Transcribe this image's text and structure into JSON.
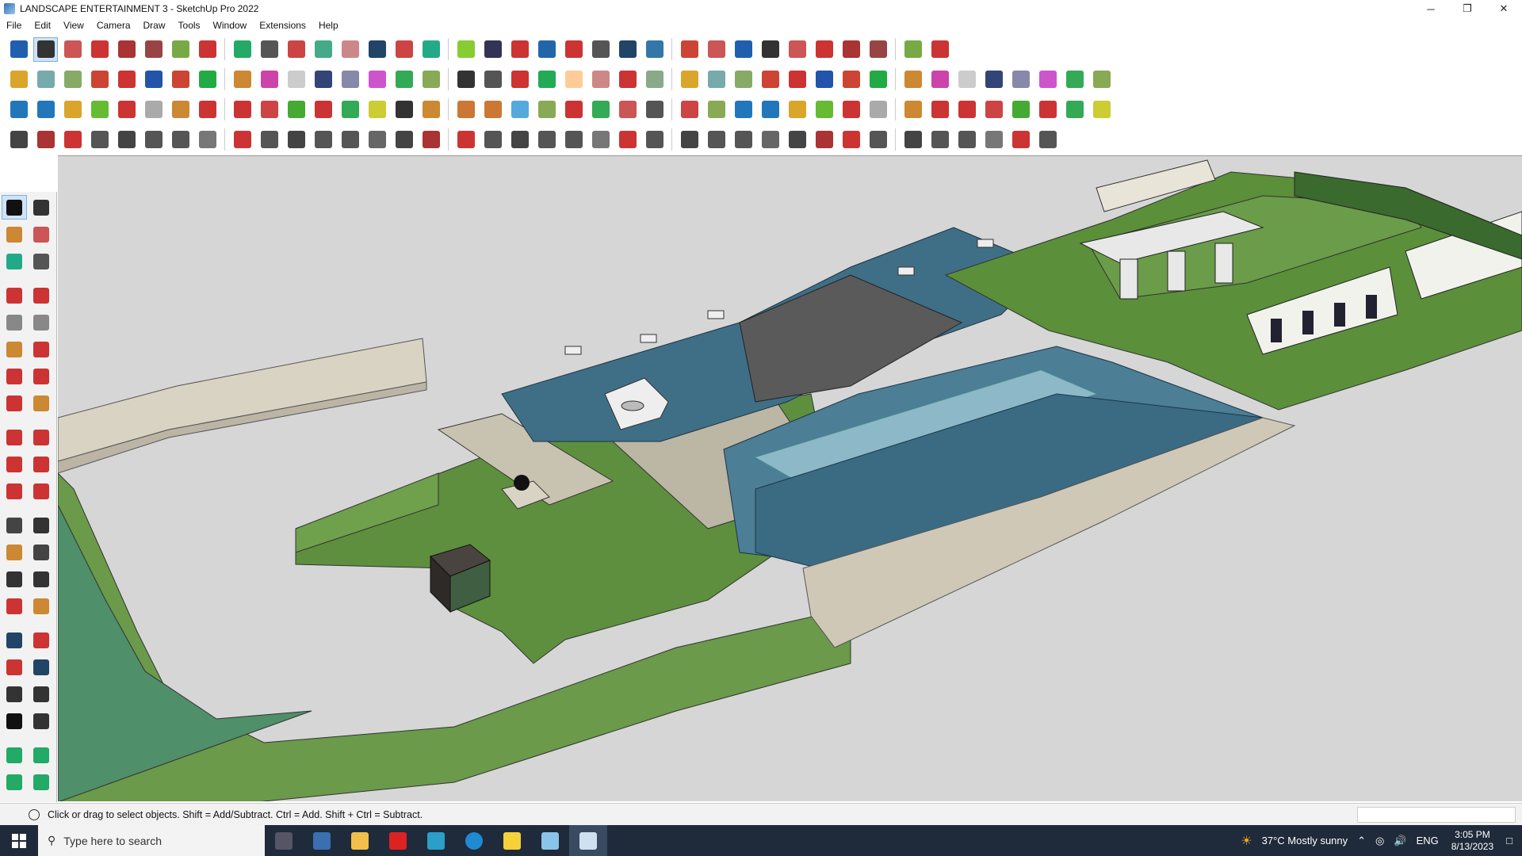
{
  "window": {
    "title": "LANDSCAPE ENTERTAINMENT 3 - SketchUp Pro 2022",
    "minimize": "─",
    "restore": "❐",
    "close": "✕"
  },
  "menu": [
    "File",
    "Edit",
    "View",
    "Camera",
    "Draw",
    "Tools",
    "Window",
    "Extensions",
    "Help"
  ],
  "toolbar_rows": [
    {
      "count": 34,
      "colors": [
        "#1f5fae",
        "#333",
        "#c55",
        "#c33",
        "#a33",
        "#944",
        "#7a4",
        "#c33",
        "#2a6",
        "#555",
        "#c44",
        "#4a8",
        "#c88",
        "#246",
        "#c44",
        "#2a8",
        "#8c3",
        "#335",
        "#c33",
        "#26a",
        "#c33",
        "#555",
        "#246",
        "#37a",
        "#c43",
        "#c55"
      ]
    },
    {
      "count": 40,
      "colors": [
        "#d9a52b",
        "#7aa",
        "#8a6",
        "#c43",
        "#c33",
        "#25a",
        "#c43",
        "#2a4",
        "#c83",
        "#c4a",
        "#ccc",
        "#347",
        "#88a",
        "#c5c",
        "#3a5",
        "#8a5",
        "#333",
        "#555",
        "#c33",
        "#2a5",
        "#fc9",
        "#c88",
        "#c33",
        "#8a8"
      ]
    },
    {
      "count": 40,
      "colors": [
        "#27b",
        "#27b",
        "#d9a52b",
        "#6b3",
        "#c33",
        "#aaa",
        "#c83",
        "#c33",
        "#c33",
        "#c44",
        "#4a3",
        "#c33",
        "#3a5",
        "#cc3",
        "#333",
        "#c83",
        "#c73",
        "#c73",
        "#5ad",
        "#8a5",
        "#c33",
        "#3a5",
        "#c55",
        "#555",
        "#c44",
        "#8a5"
      ]
    },
    {
      "count": 38,
      "colors": [
        "#444",
        "#a33",
        "#c33",
        "#555",
        "#444",
        "#555",
        "#555",
        "#777",
        "#c33",
        "#555",
        "#444",
        "#555",
        "#555",
        "#666"
      ]
    }
  ],
  "left_tools": {
    "count": 44,
    "colors": [
      "#111",
      "#333",
      "#c83",
      "#c55",
      "#2a8",
      "#555",
      "#c33",
      "#c33",
      "#888",
      "#888",
      "#c83",
      "#c33",
      "#c33",
      "#c33",
      "#c33",
      "#c83",
      "#c33",
      "#c33",
      "#c33",
      "#c33",
      "#c33",
      "#c33",
      "#444",
      "#333",
      "#c83",
      "#444",
      "#333",
      "#333",
      "#c33",
      "#c83",
      "#246",
      "#c33",
      "#c33",
      "#246",
      "#333",
      "#333",
      "#111",
      "#333",
      "#2a6",
      "#2a6",
      "#2a6",
      "#2a6"
    ]
  },
  "status": {
    "text": "Click or drag to select objects. Shift = Add/Subtract. Ctrl = Add. Shift + Ctrl = Subtract."
  },
  "taskbar": {
    "search_placeholder": "Type here to search",
    "weather": "37°C  Mostly sunny",
    "lang": "ENG",
    "time": "3:05 PM",
    "date": "8/13/2023"
  }
}
